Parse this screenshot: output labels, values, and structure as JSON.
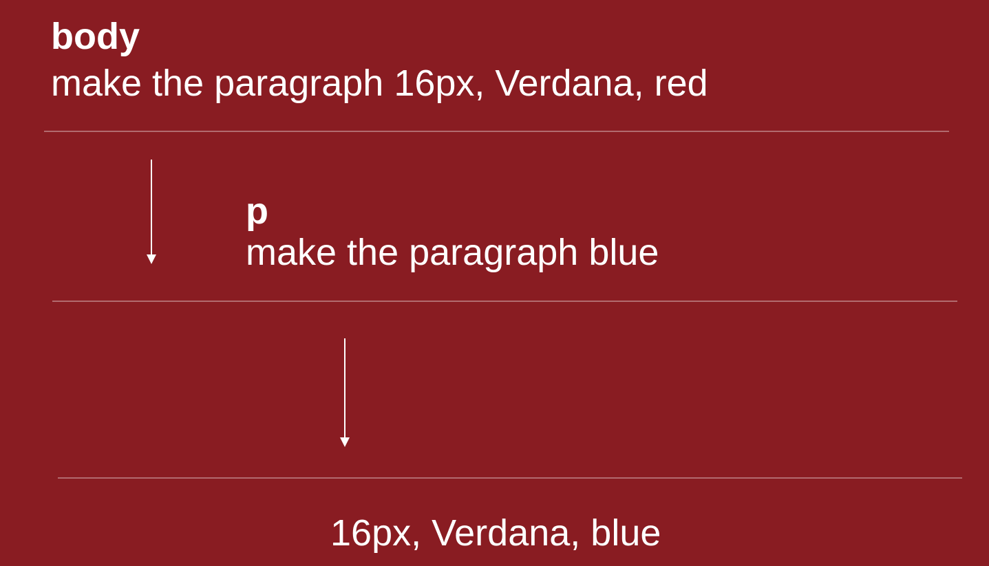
{
  "rules": [
    {
      "selector": "body",
      "declaration": "make the paragraph 16px, Verdana, red"
    },
    {
      "selector": "p",
      "declaration": "make the paragraph blue"
    }
  ],
  "result": "16px, Verdana, blue"
}
